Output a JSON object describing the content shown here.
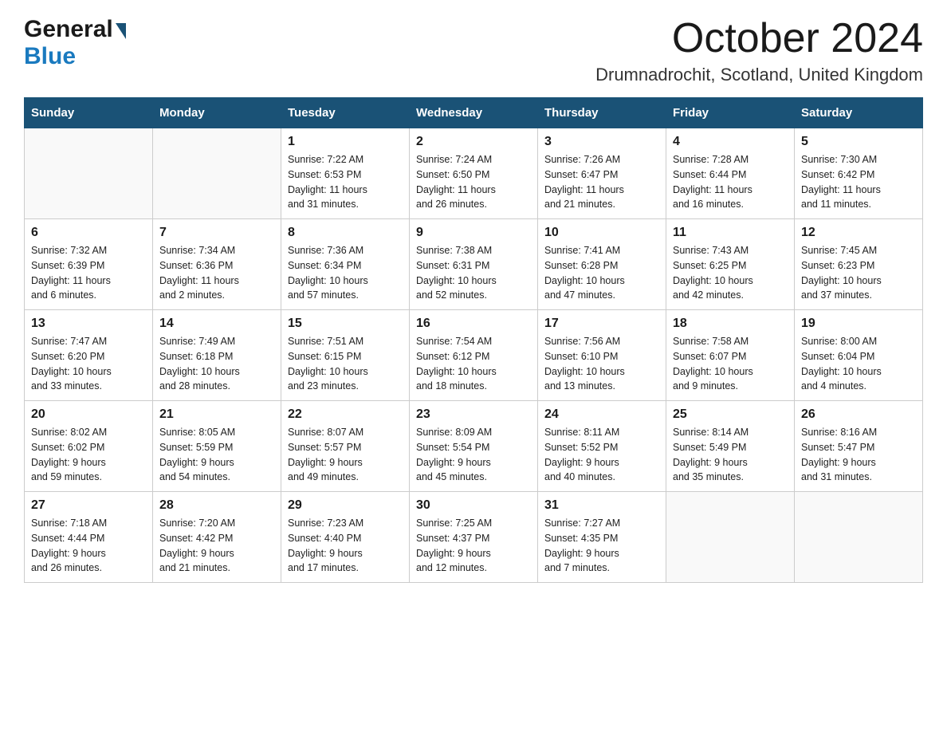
{
  "header": {
    "logo_general": "General",
    "logo_blue": "Blue",
    "month_title": "October 2024",
    "location": "Drumnadrochit, Scotland, United Kingdom"
  },
  "days_of_week": [
    "Sunday",
    "Monday",
    "Tuesday",
    "Wednesday",
    "Thursday",
    "Friday",
    "Saturday"
  ],
  "weeks": [
    [
      {
        "day": "",
        "info": ""
      },
      {
        "day": "",
        "info": ""
      },
      {
        "day": "1",
        "info": "Sunrise: 7:22 AM\nSunset: 6:53 PM\nDaylight: 11 hours\nand 31 minutes."
      },
      {
        "day": "2",
        "info": "Sunrise: 7:24 AM\nSunset: 6:50 PM\nDaylight: 11 hours\nand 26 minutes."
      },
      {
        "day": "3",
        "info": "Sunrise: 7:26 AM\nSunset: 6:47 PM\nDaylight: 11 hours\nand 21 minutes."
      },
      {
        "day": "4",
        "info": "Sunrise: 7:28 AM\nSunset: 6:44 PM\nDaylight: 11 hours\nand 16 minutes."
      },
      {
        "day": "5",
        "info": "Sunrise: 7:30 AM\nSunset: 6:42 PM\nDaylight: 11 hours\nand 11 minutes."
      }
    ],
    [
      {
        "day": "6",
        "info": "Sunrise: 7:32 AM\nSunset: 6:39 PM\nDaylight: 11 hours\nand 6 minutes."
      },
      {
        "day": "7",
        "info": "Sunrise: 7:34 AM\nSunset: 6:36 PM\nDaylight: 11 hours\nand 2 minutes."
      },
      {
        "day": "8",
        "info": "Sunrise: 7:36 AM\nSunset: 6:34 PM\nDaylight: 10 hours\nand 57 minutes."
      },
      {
        "day": "9",
        "info": "Sunrise: 7:38 AM\nSunset: 6:31 PM\nDaylight: 10 hours\nand 52 minutes."
      },
      {
        "day": "10",
        "info": "Sunrise: 7:41 AM\nSunset: 6:28 PM\nDaylight: 10 hours\nand 47 minutes."
      },
      {
        "day": "11",
        "info": "Sunrise: 7:43 AM\nSunset: 6:25 PM\nDaylight: 10 hours\nand 42 minutes."
      },
      {
        "day": "12",
        "info": "Sunrise: 7:45 AM\nSunset: 6:23 PM\nDaylight: 10 hours\nand 37 minutes."
      }
    ],
    [
      {
        "day": "13",
        "info": "Sunrise: 7:47 AM\nSunset: 6:20 PM\nDaylight: 10 hours\nand 33 minutes."
      },
      {
        "day": "14",
        "info": "Sunrise: 7:49 AM\nSunset: 6:18 PM\nDaylight: 10 hours\nand 28 minutes."
      },
      {
        "day": "15",
        "info": "Sunrise: 7:51 AM\nSunset: 6:15 PM\nDaylight: 10 hours\nand 23 minutes."
      },
      {
        "day": "16",
        "info": "Sunrise: 7:54 AM\nSunset: 6:12 PM\nDaylight: 10 hours\nand 18 minutes."
      },
      {
        "day": "17",
        "info": "Sunrise: 7:56 AM\nSunset: 6:10 PM\nDaylight: 10 hours\nand 13 minutes."
      },
      {
        "day": "18",
        "info": "Sunrise: 7:58 AM\nSunset: 6:07 PM\nDaylight: 10 hours\nand 9 minutes."
      },
      {
        "day": "19",
        "info": "Sunrise: 8:00 AM\nSunset: 6:04 PM\nDaylight: 10 hours\nand 4 minutes."
      }
    ],
    [
      {
        "day": "20",
        "info": "Sunrise: 8:02 AM\nSunset: 6:02 PM\nDaylight: 9 hours\nand 59 minutes."
      },
      {
        "day": "21",
        "info": "Sunrise: 8:05 AM\nSunset: 5:59 PM\nDaylight: 9 hours\nand 54 minutes."
      },
      {
        "day": "22",
        "info": "Sunrise: 8:07 AM\nSunset: 5:57 PM\nDaylight: 9 hours\nand 49 minutes."
      },
      {
        "day": "23",
        "info": "Sunrise: 8:09 AM\nSunset: 5:54 PM\nDaylight: 9 hours\nand 45 minutes."
      },
      {
        "day": "24",
        "info": "Sunrise: 8:11 AM\nSunset: 5:52 PM\nDaylight: 9 hours\nand 40 minutes."
      },
      {
        "day": "25",
        "info": "Sunrise: 8:14 AM\nSunset: 5:49 PM\nDaylight: 9 hours\nand 35 minutes."
      },
      {
        "day": "26",
        "info": "Sunrise: 8:16 AM\nSunset: 5:47 PM\nDaylight: 9 hours\nand 31 minutes."
      }
    ],
    [
      {
        "day": "27",
        "info": "Sunrise: 7:18 AM\nSunset: 4:44 PM\nDaylight: 9 hours\nand 26 minutes."
      },
      {
        "day": "28",
        "info": "Sunrise: 7:20 AM\nSunset: 4:42 PM\nDaylight: 9 hours\nand 21 minutes."
      },
      {
        "day": "29",
        "info": "Sunrise: 7:23 AM\nSunset: 4:40 PM\nDaylight: 9 hours\nand 17 minutes."
      },
      {
        "day": "30",
        "info": "Sunrise: 7:25 AM\nSunset: 4:37 PM\nDaylight: 9 hours\nand 12 minutes."
      },
      {
        "day": "31",
        "info": "Sunrise: 7:27 AM\nSunset: 4:35 PM\nDaylight: 9 hours\nand 7 minutes."
      },
      {
        "day": "",
        "info": ""
      },
      {
        "day": "",
        "info": ""
      }
    ]
  ]
}
